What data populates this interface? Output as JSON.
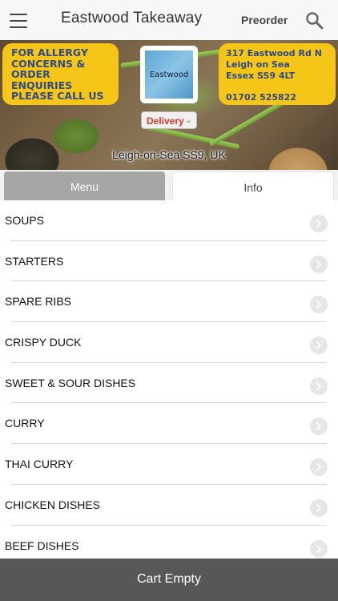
{
  "header": {
    "title": "Eastwood Takeaway",
    "preorder_label": "Preorder"
  },
  "banner": {
    "allergy_lines": [
      "FOR ALLERGY",
      "CONCERNS &",
      "ORDER",
      "ENQUIRIES",
      "PLEASE CALL US"
    ],
    "address_lines": [
      "317 Eastwood Rd N",
      "Leigh on Sea",
      "Essex SS9 4LT"
    ],
    "phone": "01702 525822",
    "logo_text": "Eastwood",
    "delivery_label": "Delivery",
    "location": "Leigh-on-Sea SS9, UK"
  },
  "tabs": {
    "menu_label": "Menu",
    "info_label": "Info"
  },
  "menu_categories": [
    "SOUPS",
    "STARTERS",
    "SPARE RIBS",
    "CRISPY DUCK",
    "SWEET & SOUR DISHES",
    "CURRY",
    "THAI CURRY",
    "CHICKEN DISHES",
    "BEEF DISHES"
  ],
  "cart": {
    "label": "Cart Empty"
  },
  "colors": {
    "accent_yellow": "#f5c518",
    "banner_text_blue": "#2f4a8a",
    "delivery_red": "#d23a2a",
    "cart_bar": "#575757",
    "tab_active": "#a6a6a6"
  }
}
